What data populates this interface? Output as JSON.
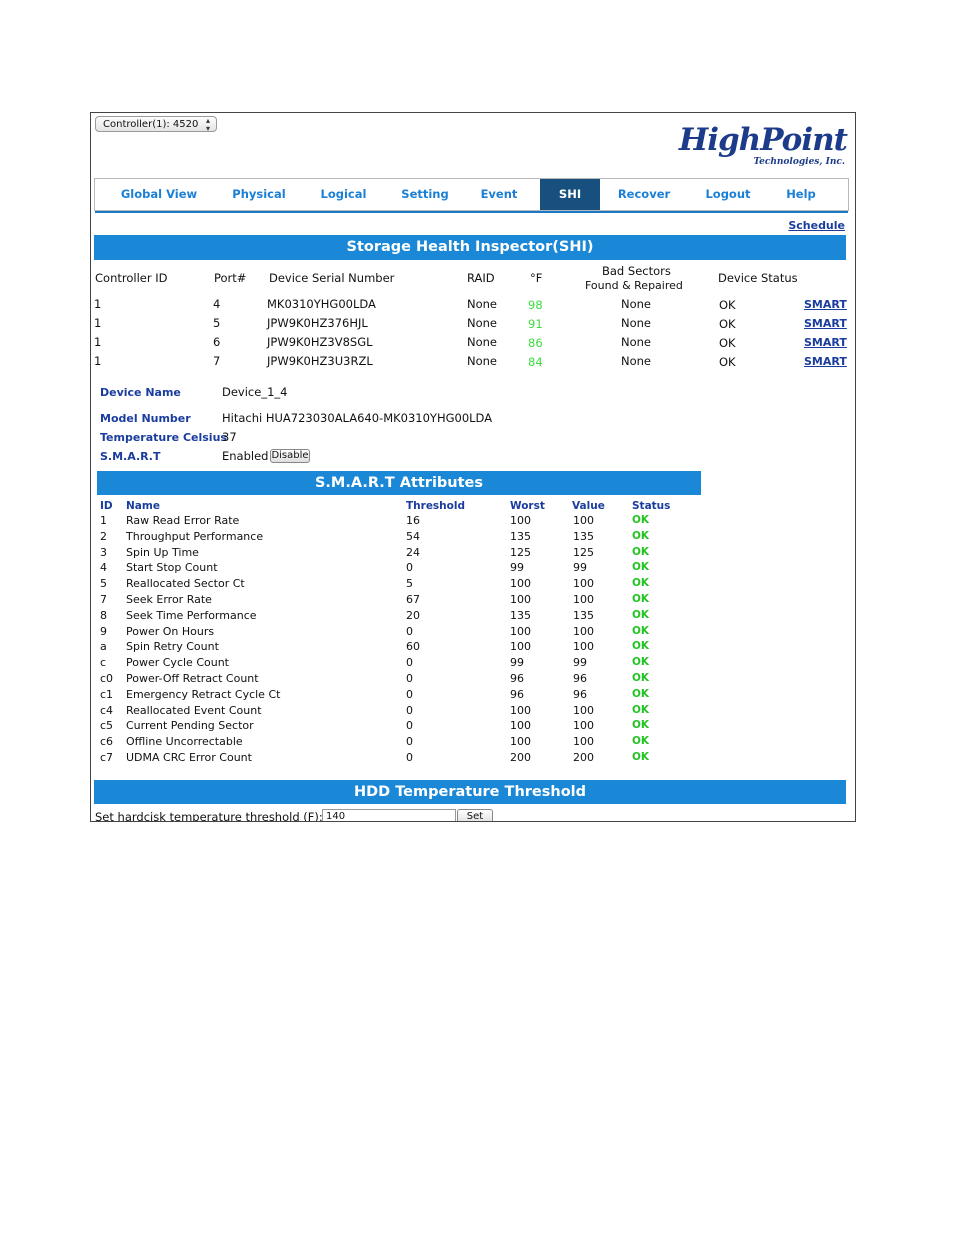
{
  "controller": {
    "selected": "Controller(1): 4520"
  },
  "logo": {
    "brand": "HighPoint",
    "subtitle": "Technologies, Inc."
  },
  "nav": {
    "tabs": [
      {
        "label": "Global View"
      },
      {
        "label": "Physical"
      },
      {
        "label": "Logical"
      },
      {
        "label": "Setting"
      },
      {
        "label": "Event"
      },
      {
        "label": "SHI",
        "active": true
      },
      {
        "label": "Recover"
      },
      {
        "label": "Logout"
      },
      {
        "label": "Help"
      }
    ],
    "accent": "#1b7fd6",
    "active_bg": "#17507f"
  },
  "schedule_link": "Schedule",
  "shi": {
    "title": "Storage Health Inspector(SHI)",
    "headers": {
      "controller_id": "Controller ID",
      "port": "Port#",
      "serial": "Device Serial Number",
      "raid": "RAID",
      "temp": "°F",
      "bad_sectors_line1": "Bad Sectors",
      "bad_sectors_line2": "Found & Repaired",
      "status": "Device Status"
    },
    "rows": [
      {
        "controller": "1",
        "port": "4",
        "serial": "MK0310YHG00LDA",
        "raid": "None",
        "temp": "98",
        "bad": "None",
        "status": "OK",
        "link": "SMART"
      },
      {
        "controller": "1",
        "port": "5",
        "serial": "JPW9K0HZ376HJL",
        "raid": "None",
        "temp": "91",
        "bad": "None",
        "status": "OK",
        "link": "SMART"
      },
      {
        "controller": "1",
        "port": "6",
        "serial": "JPW9K0HZ3V8SGL",
        "raid": "None",
        "temp": "86",
        "bad": "None",
        "status": "OK",
        "link": "SMART"
      },
      {
        "controller": "1",
        "port": "7",
        "serial": "JPW9K0HZ3U3RZL",
        "raid": "None",
        "temp": "84",
        "bad": "None",
        "status": "OK",
        "link": "SMART"
      }
    ]
  },
  "device": {
    "name_label": "Device Name",
    "name": "Device_1_4",
    "model_label": "Model Number",
    "model": "Hitachi HUA723030ALA640-MK0310YHG00LDA",
    "temp_label": "Temperature Celsius",
    "temp": "37",
    "smart_label": "S.M.A.R.T",
    "smart_state": "Enabled",
    "disable_button": "Disable"
  },
  "attributes": {
    "title": "S.M.A.R.T Attributes",
    "headers": {
      "id": "ID",
      "name": "Name",
      "threshold": "Threshold",
      "worst": "Worst",
      "value": "Value",
      "status": "Status"
    },
    "rows": [
      {
        "id": "1",
        "name": "Raw Read Error Rate",
        "threshold": "16",
        "worst": "100",
        "value": "100",
        "status": "OK"
      },
      {
        "id": "2",
        "name": "Throughput Performance",
        "threshold": "54",
        "worst": "135",
        "value": "135",
        "status": "OK"
      },
      {
        "id": "3",
        "name": "Spin Up Time",
        "threshold": "24",
        "worst": "125",
        "value": "125",
        "status": "OK"
      },
      {
        "id": "4",
        "name": "Start Stop Count",
        "threshold": "0",
        "worst": "99",
        "value": "99",
        "status": "OK"
      },
      {
        "id": "5",
        "name": "Reallocated Sector Ct",
        "threshold": "5",
        "worst": "100",
        "value": "100",
        "status": "OK"
      },
      {
        "id": "7",
        "name": "Seek Error Rate",
        "threshold": "67",
        "worst": "100",
        "value": "100",
        "status": "OK"
      },
      {
        "id": "8",
        "name": "Seek Time Performance",
        "threshold": "20",
        "worst": "135",
        "value": "135",
        "status": "OK"
      },
      {
        "id": "9",
        "name": "Power On Hours",
        "threshold": "0",
        "worst": "100",
        "value": "100",
        "status": "OK"
      },
      {
        "id": "a",
        "name": "Spin Retry Count",
        "threshold": "60",
        "worst": "100",
        "value": "100",
        "status": "OK"
      },
      {
        "id": "c",
        "name": "Power Cycle Count",
        "threshold": "0",
        "worst": "99",
        "value": "99",
        "status": "OK"
      },
      {
        "id": "c0",
        "name": "Power-Off Retract Count",
        "threshold": "0",
        "worst": "96",
        "value": "96",
        "status": "OK"
      },
      {
        "id": "c1",
        "name": "Emergency Retract Cycle Ct",
        "threshold": "0",
        "worst": "96",
        "value": "96",
        "status": "OK"
      },
      {
        "id": "c4",
        "name": "Reallocated Event Count",
        "threshold": "0",
        "worst": "100",
        "value": "100",
        "status": "OK"
      },
      {
        "id": "c5",
        "name": "Current Pending Sector",
        "threshold": "0",
        "worst": "100",
        "value": "100",
        "status": "OK"
      },
      {
        "id": "c6",
        "name": "Offline Uncorrectable",
        "threshold": "0",
        "worst": "100",
        "value": "100",
        "status": "OK"
      },
      {
        "id": "c7",
        "name": "UDMA CRC Error Count",
        "threshold": "0",
        "worst": "200",
        "value": "200",
        "status": "OK"
      }
    ]
  },
  "hdd_threshold": {
    "title": "HDD Temperature Threshold",
    "label": "Set hardcisk temperature threshold (F):",
    "value": "140",
    "set_button": "Set"
  }
}
